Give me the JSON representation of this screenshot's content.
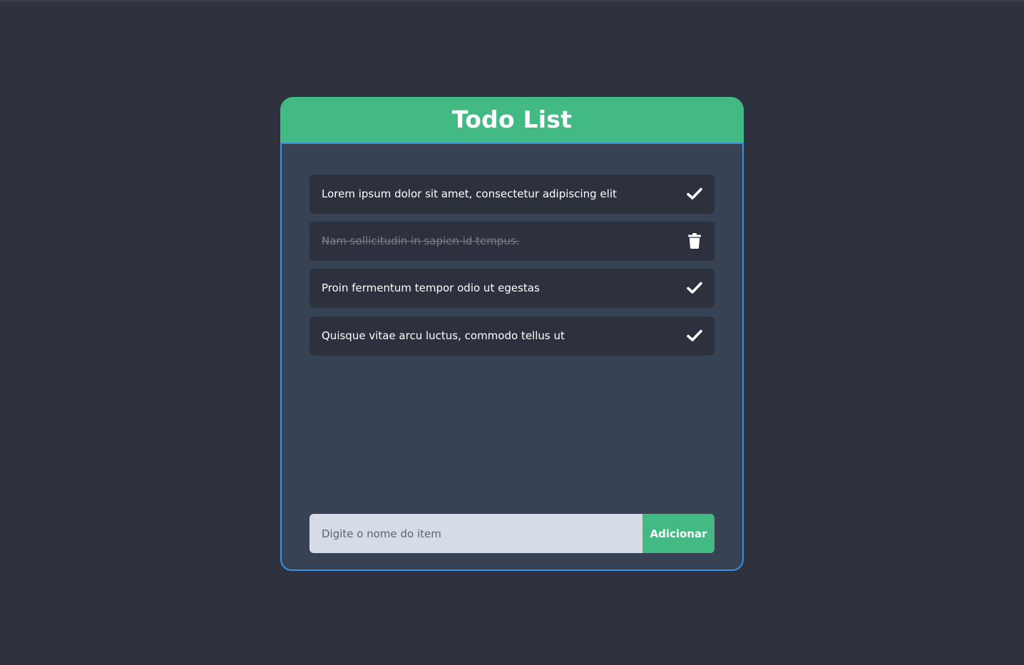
{
  "app": {
    "title": "Todo List"
  },
  "colors": {
    "background": "#2d323e",
    "header": "#43b984",
    "body": "#374254",
    "border": "#2f93e8",
    "item": "#2c313d",
    "input": "#d5dce6",
    "button": "#43b984"
  },
  "todos": [
    {
      "text": "Lorem ipsum dolor sit amet, consectetur adipiscing elit",
      "completed": false,
      "action_icon": "check-icon"
    },
    {
      "text": "Nam sollicitudin in sapien id tempus.",
      "completed": true,
      "action_icon": "trash-icon"
    },
    {
      "text": "Proin fermentum tempor odio ut egestas",
      "completed": false,
      "action_icon": "check-icon"
    },
    {
      "text": "Quisque vitae arcu luctus, commodo tellus ut",
      "completed": false,
      "action_icon": "check-icon"
    }
  ],
  "form": {
    "input_value": "",
    "input_placeholder": "Digite o nome do item",
    "button_label": "Adicionar"
  }
}
